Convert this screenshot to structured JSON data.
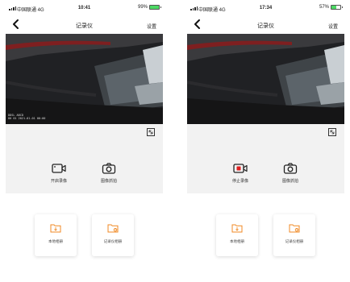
{
  "screens": [
    {
      "status": {
        "carrier": "中国联通  4G",
        "time": "10:41",
        "battery": "99%",
        "battery_level": 0.99
      },
      "nav": {
        "back_icon": "chevron-left-icon",
        "title": "记录仪",
        "settings": "设置"
      },
      "video": {
        "osd_line1": "DDSL ABCD",
        "osd_line2": "80  01  2021-01-01 00:00"
      },
      "controls": {
        "record_label": "开启录像",
        "record_icon": "video-camera-icon",
        "record_active": false,
        "snapshot_label": "图像抓拍",
        "snapshot_icon": "camera-icon",
        "fullscreen_icon": "fullscreen-icon"
      },
      "albums": [
        {
          "label": "本地相册",
          "icon": "folder-download-icon"
        },
        {
          "label": "记录仪相册",
          "icon": "folder-image-icon"
        }
      ]
    },
    {
      "status": {
        "carrier": "中国联通  4G",
        "time": "17:34",
        "battery": "57%",
        "battery_level": 0.57
      },
      "nav": {
        "back_icon": "chevron-left-icon",
        "title": "记录仪",
        "settings": "设置"
      },
      "video": {
        "osd_line1": "DDSL ABCD",
        "osd_line2": "80  01  2021-01-01 00:00"
      },
      "controls": {
        "record_label": "停止录像",
        "record_icon": "video-camera-recording-icon",
        "record_active": true,
        "snapshot_label": "图像抓拍",
        "snapshot_icon": "camera-icon",
        "fullscreen_icon": "fullscreen-icon"
      },
      "albums": [
        {
          "label": "本地相册",
          "icon": "folder-download-icon"
        },
        {
          "label": "记录仪相册",
          "icon": "folder-image-icon"
        }
      ]
    }
  ],
  "colors": {
    "accent": "#f08a24",
    "record_red": "#e02020",
    "battery_green": "#4cd964"
  }
}
